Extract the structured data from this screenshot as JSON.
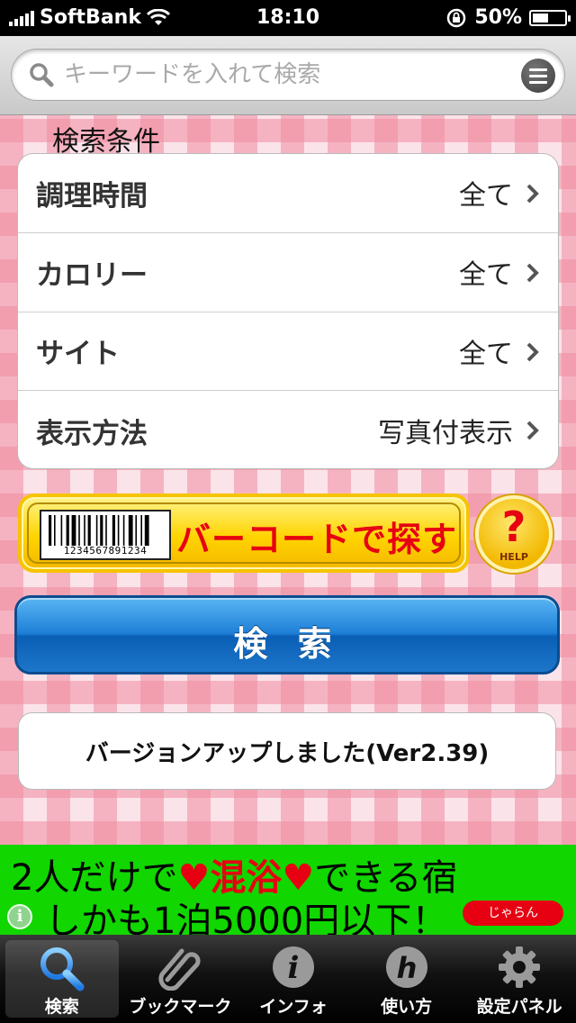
{
  "status": {
    "carrier": "SoftBank",
    "time": "18:10",
    "battery": "50%",
    "battery_level": 0.5
  },
  "search": {
    "placeholder": "キーワードを入れて検索",
    "value": ""
  },
  "conditions": {
    "title": "検索条件",
    "rows": [
      {
        "label": "調理時間",
        "value": "全て"
      },
      {
        "label": "カロリー",
        "value": "全て"
      },
      {
        "label": "サイト",
        "value": "全て"
      },
      {
        "label": "表示方法",
        "value": "写真付表示"
      }
    ]
  },
  "barcode": {
    "label": "バーコードで探す",
    "number": "1234567891234"
  },
  "help": {
    "label": "HELP"
  },
  "search_button": {
    "label": "検 索"
  },
  "notice": {
    "text": "バージョンアップしました(Ver2.39)"
  },
  "ad": {
    "line1_a": "2人だけで",
    "line1_hi": "混浴",
    "line1_b": "できる宿",
    "line2": "しかも1泊5000円以下！",
    "brand": "じゃらん"
  },
  "tabs": [
    {
      "label": "検索",
      "icon": "search-icon",
      "active": true
    },
    {
      "label": "ブックマーク",
      "icon": "paperclip-icon",
      "active": false
    },
    {
      "label": "インフォ",
      "icon": "info-icon",
      "active": false
    },
    {
      "label": "使い方",
      "icon": "help-h-icon",
      "active": false
    },
    {
      "label": "設定パネル",
      "icon": "gear-icon",
      "active": false
    }
  ],
  "colors": {
    "accent_blue": "#1e7fd6",
    "barcode_red": "#e60012",
    "ad_green": "#11d600",
    "active_tab": "#2f8ff0"
  }
}
